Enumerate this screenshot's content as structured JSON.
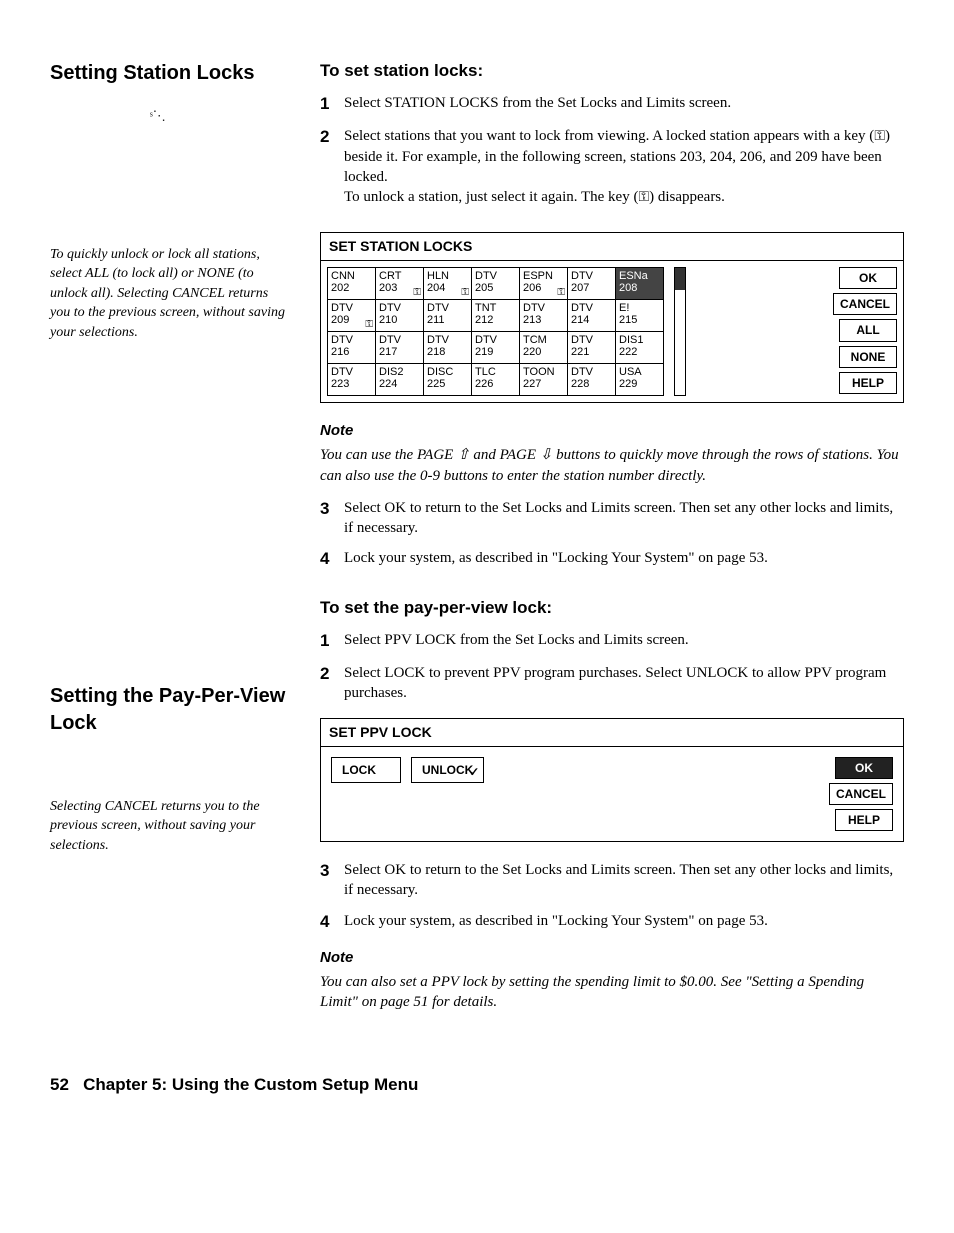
{
  "s1": {
    "title": "Setting Station Locks",
    "sidenote": "To quickly unlock or lock all stations, select ALL (to lock all) or NONE (to unlock all). Selecting CANCEL returns you to the previous screen, without saving your selections.",
    "subtitle": "To set station locks:",
    "step1": "Select STATION LOCKS from the Set Locks and Limits screen.",
    "step2a": "Select stations that you want to lock from viewing. A locked station appears with a key (",
    "step2b": ") beside it. For example, in the following screen, stations 203, 204, 206, and 209 have been locked.",
    "step2c_a": "To unlock a station, just select it again. The key (",
    "step2c_b": ") disappears.",
    "noteHead": "Note",
    "noteBody": "You can use the PAGE ⇧ and PAGE ⇩ buttons to quickly move through the rows of stations. You can also use the 0-9 buttons to enter the station number directly.",
    "step3": "Select OK to return to the Set Locks and Limits screen. Then set any other locks and limits, if necessary.",
    "step4": "Lock your system, as described in \"Locking Your System\" on page 53."
  },
  "panel1": {
    "title": "SET STATION LOCKS",
    "cells": [
      {
        "a": "CNN",
        "n": "202",
        "sel": false,
        "key": false
      },
      {
        "a": "CRT",
        "n": "203",
        "sel": false,
        "key": true
      },
      {
        "a": "HLN",
        "n": "204",
        "sel": false,
        "key": true
      },
      {
        "a": "DTV",
        "n": "205",
        "sel": false,
        "key": false
      },
      {
        "a": "ESPN",
        "n": "206",
        "sel": false,
        "key": true
      },
      {
        "a": "DTV",
        "n": "207",
        "sel": false,
        "key": false
      },
      {
        "a": "ESNa",
        "n": "208",
        "sel": true,
        "key": false
      },
      {
        "a": "DTV",
        "n": "209",
        "sel": false,
        "key": true
      },
      {
        "a": "DTV",
        "n": "210",
        "sel": false,
        "key": false
      },
      {
        "a": "DTV",
        "n": "211",
        "sel": false,
        "key": false
      },
      {
        "a": "TNT",
        "n": "212",
        "sel": false,
        "key": false
      },
      {
        "a": "DTV",
        "n": "213",
        "sel": false,
        "key": false
      },
      {
        "a": "DTV",
        "n": "214",
        "sel": false,
        "key": false
      },
      {
        "a": "E!",
        "n": "215",
        "sel": false,
        "key": false
      },
      {
        "a": "DTV",
        "n": "216",
        "sel": false,
        "key": false
      },
      {
        "a": "DTV",
        "n": "217",
        "sel": false,
        "key": false
      },
      {
        "a": "DTV",
        "n": "218",
        "sel": false,
        "key": false
      },
      {
        "a": "DTV",
        "n": "219",
        "sel": false,
        "key": false
      },
      {
        "a": "TCM",
        "n": "220",
        "sel": false,
        "key": false
      },
      {
        "a": "DTV",
        "n": "221",
        "sel": false,
        "key": false
      },
      {
        "a": "DIS1",
        "n": "222",
        "sel": false,
        "key": false
      },
      {
        "a": "DTV",
        "n": "223",
        "sel": false,
        "key": false
      },
      {
        "a": "DIS2",
        "n": "224",
        "sel": false,
        "key": false
      },
      {
        "a": "DISC",
        "n": "225",
        "sel": false,
        "key": false
      },
      {
        "a": "TLC",
        "n": "226",
        "sel": false,
        "key": false
      },
      {
        "a": "TOON",
        "n": "227",
        "sel": false,
        "key": false
      },
      {
        "a": "DTV",
        "n": "228",
        "sel": false,
        "key": false
      },
      {
        "a": "USA",
        "n": "229",
        "sel": false,
        "key": false
      }
    ],
    "btns": {
      "ok": "OK",
      "cancel": "CANCEL",
      "all": "ALL",
      "none": "NONE",
      "help": "HELP"
    }
  },
  "s2": {
    "title": "Setting the Pay-Per-View Lock",
    "sidenote": "Selecting CANCEL returns you to the previous screen, without saving your selections.",
    "subtitle": "To set the pay-per-view lock:",
    "step1": "Select PPV LOCK from the Set Locks and Limits screen.",
    "step2": "Select LOCK to prevent PPV program purchases. Select UNLOCK to allow PPV program purchases.",
    "step3": "Select OK to return to the Set Locks and Limits screen. Then set any other locks and limits, if necessary.",
    "step4": "Lock your system, as described in \"Locking Your System\" on page 53.",
    "noteHead": "Note",
    "noteBody": "You can also set a PPV lock by setting the spending limit to $0.00. See \"Setting a Spending Limit\" on page 51 for details."
  },
  "panel2": {
    "title": "SET PPV LOCK",
    "lock": "LOCK",
    "unlock": "UNLOCK",
    "btns": {
      "ok": "OK",
      "cancel": "CANCEL",
      "help": "HELP"
    }
  },
  "footer": {
    "pageNum": "52",
    "chapter": "Chapter 5: Using the Custom Setup Menu"
  },
  "glyphs": {
    "key": "⚿",
    "check": "✓"
  }
}
